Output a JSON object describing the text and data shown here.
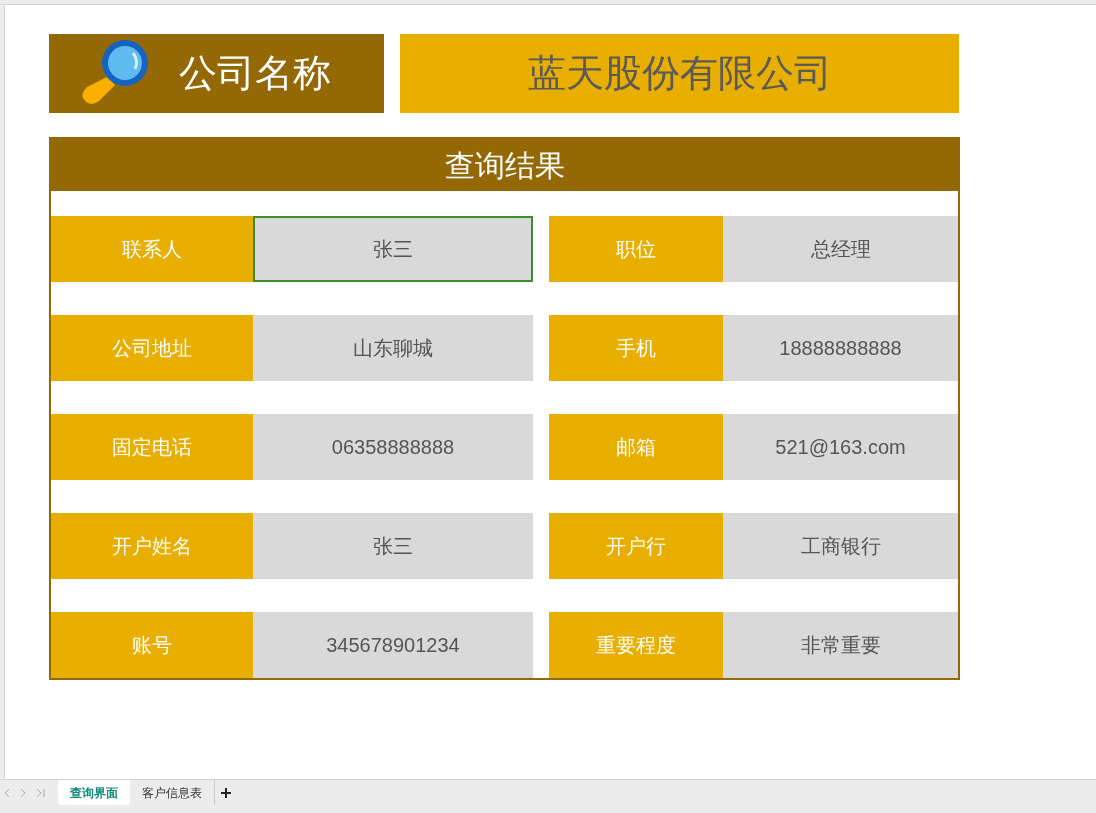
{
  "header": {
    "label": "公司名称",
    "company": "蓝天股份有限公司"
  },
  "panel": {
    "title": "查询结果",
    "rows": [
      [
        {
          "label": "联系人",
          "value": "张三",
          "selected": true
        },
        {
          "label": "职位",
          "value": "总经理",
          "selected": false
        }
      ],
      [
        {
          "label": "公司地址",
          "value": "山东聊城",
          "selected": false
        },
        {
          "label": "手机",
          "value": "18888888888",
          "selected": false
        }
      ],
      [
        {
          "label": "固定电话",
          "value": "06358888888",
          "selected": false
        },
        {
          "label": "邮箱",
          "value": "521@163.com",
          "selected": false
        }
      ],
      [
        {
          "label": "开户姓名",
          "value": "张三",
          "selected": false
        },
        {
          "label": "开户行",
          "value": "工商银行",
          "selected": false
        }
      ],
      [
        {
          "label": "账号",
          "value": "345678901234",
          "selected": false
        },
        {
          "label": "重要程度",
          "value": "非常重要",
          "selected": false
        }
      ]
    ]
  },
  "sheet_tabs": [
    {
      "label": "查询界面",
      "selected": true
    },
    {
      "label": "客户信息表",
      "selected": false
    }
  ]
}
